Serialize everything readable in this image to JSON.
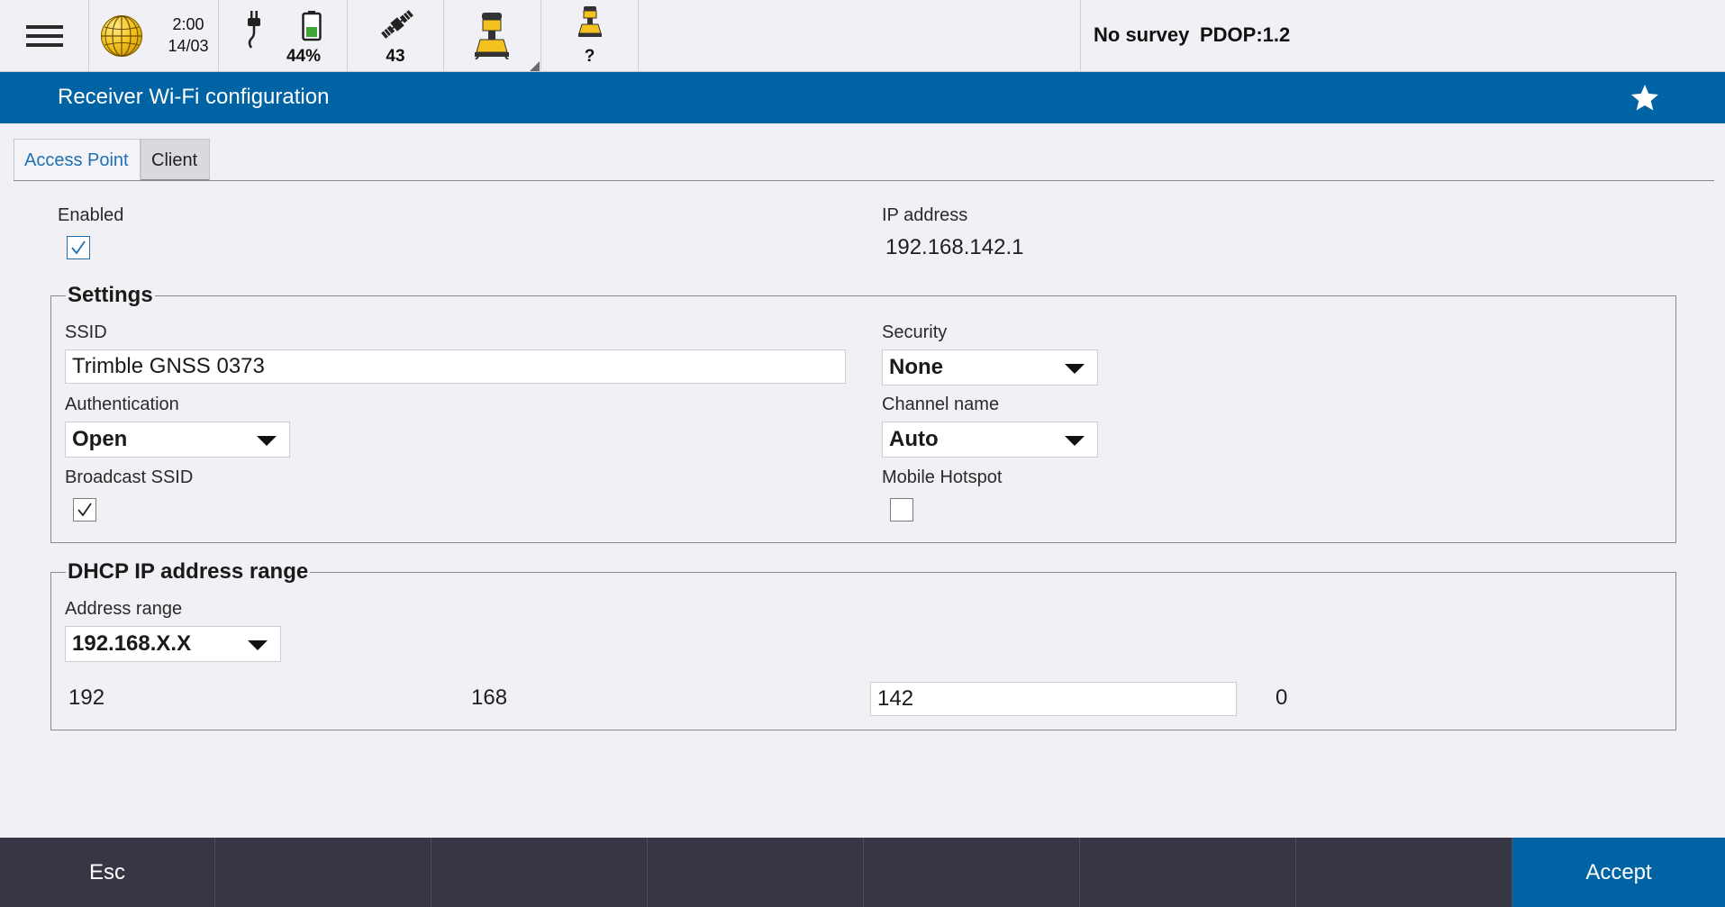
{
  "status_bar": {
    "time": "2:00",
    "date": "14/03",
    "battery_percent": "44%",
    "battery_level": 0.44,
    "satellites": "43",
    "rover2_status": "?",
    "survey_status": "No survey",
    "pdop": "PDOP:1.2"
  },
  "title_bar": {
    "title": "Receiver Wi-Fi configuration"
  },
  "tabs": [
    {
      "label": "Access Point",
      "active": true
    },
    {
      "label": "Client",
      "active": false
    }
  ],
  "access_point": {
    "enabled_label": "Enabled",
    "enabled": true,
    "ip_address_label": "IP address",
    "ip_address": "192.168.142.1",
    "settings": {
      "legend": "Settings",
      "ssid_label": "SSID",
      "ssid_value": "Trimble GNSS 0373",
      "security_label": "Security",
      "security_value": "None",
      "authentication_label": "Authentication",
      "authentication_value": "Open",
      "channel_label": "Channel name",
      "channel_value": "Auto",
      "broadcast_ssid_label": "Broadcast SSID",
      "broadcast_ssid": true,
      "mobile_hotspot_label": "Mobile Hotspot",
      "mobile_hotspot": false
    },
    "dhcp": {
      "legend": "DHCP IP address range",
      "address_range_label": "Address range",
      "address_range_value": "192.168.X.X",
      "octet1": "192",
      "octet2": "168",
      "octet3": "142",
      "octet4": "0"
    }
  },
  "bottom_bar": {
    "esc_label": "Esc",
    "accept_label": "Accept"
  },
  "colors": {
    "accent": "#0063a3",
    "bottom_bar": "#363644",
    "background": "#f1f1f5"
  }
}
